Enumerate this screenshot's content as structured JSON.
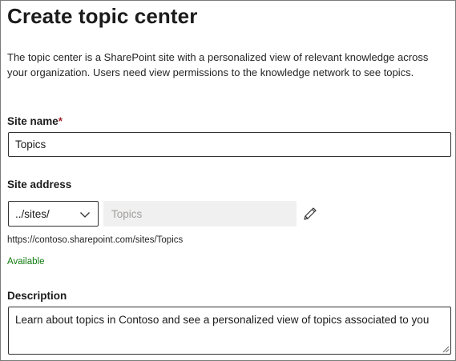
{
  "page": {
    "title": "Create topic center",
    "intro": "The topic center is a SharePoint site with a personalized view of relevant knowledge across your organization. Users need view permissions to the knowledge network to see topics."
  },
  "site_name": {
    "label": "Site name",
    "required_marker": "*",
    "value": "Topics"
  },
  "site_address": {
    "label": "Site address",
    "path_prefix": "../sites/",
    "value": "Topics",
    "full_url": "https://contoso.sharepoint.com/sites/Topics",
    "status": "Available"
  },
  "description": {
    "label": "Description",
    "value": "Learn about topics in Contoso and see a personalized view of topics associated to you"
  },
  "icons": {
    "dropdown": "chevron-down-icon",
    "edit": "pencil-icon"
  },
  "colors": {
    "required": "#a4262c",
    "available": "#107c10",
    "disabled_bg": "#f0f0f0"
  }
}
